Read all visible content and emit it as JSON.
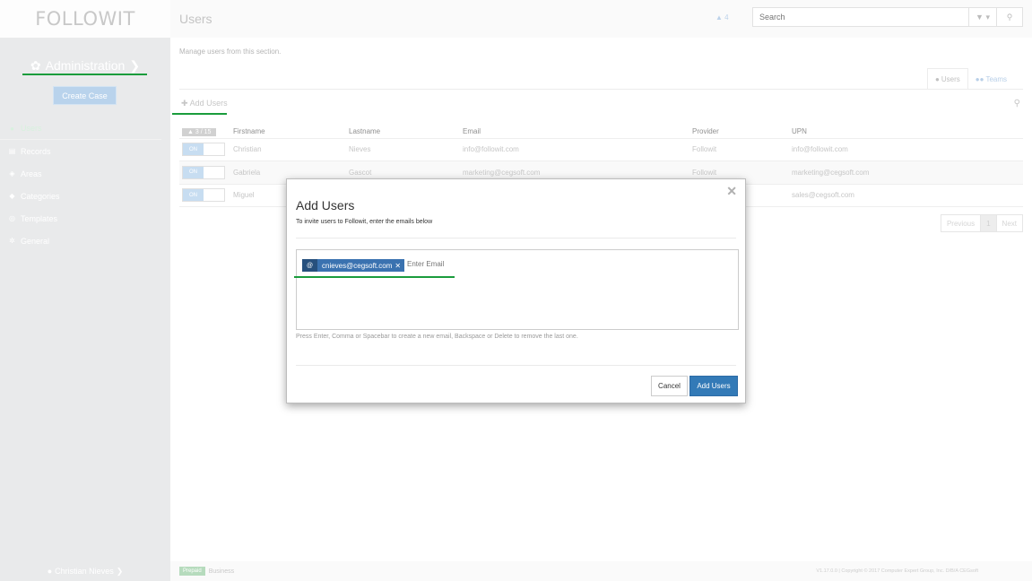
{
  "app": {
    "logo": "FOLLOWIT"
  },
  "sidebar": {
    "section_title": "Administration",
    "create_case": "Create Case",
    "items": [
      {
        "label": "Users",
        "icon": "user-icon"
      },
      {
        "label": "Records",
        "icon": "records-icon"
      },
      {
        "label": "Areas",
        "icon": "areas-icon"
      },
      {
        "label": "Categories",
        "icon": "tag-icon"
      },
      {
        "label": "Templates",
        "icon": "templates-icon"
      },
      {
        "label": "General",
        "icon": "gears-icon"
      }
    ],
    "user_name": "Christian Nieves"
  },
  "topbar": {
    "title": "Users",
    "notification_count": "4",
    "search_placeholder": "Search"
  },
  "main": {
    "subtitle": "Manage users from this section.",
    "tabs": [
      {
        "label": "Users"
      },
      {
        "label": "Teams"
      }
    ],
    "add_users_link": "Add Users",
    "table": {
      "count": "3 / 15",
      "headers": [
        "Firstname",
        "Lastname",
        "Email",
        "Provider",
        "UPN"
      ],
      "rows": [
        {
          "toggle": "ON",
          "firstname": "Christian",
          "lastname": "Nieves",
          "email": "info@followit.com",
          "provider": "Followit",
          "upn": "info@followit.com"
        },
        {
          "toggle": "ON",
          "firstname": "Gabriela",
          "lastname": "Gascot",
          "email": "marketing@cegsoft.com",
          "provider": "Followit",
          "upn": "marketing@cegsoft.com"
        },
        {
          "toggle": "ON",
          "firstname": "Miguel",
          "lastname": "",
          "email": "",
          "provider": "",
          "upn": "sales@cegsoft.com"
        }
      ]
    },
    "pager": {
      "previous": "Previous",
      "current": "1",
      "next": "Next"
    }
  },
  "footer": {
    "badge": "Prepaid",
    "plan": "Business",
    "copyright": "V1.17.0.0 | Copyright © 2017 Computer Expert Group, Inc. D/B/A CEGsoft"
  },
  "modal": {
    "title": "Add Users",
    "description": "To invite users to Followit, enter the emails below",
    "chip_email": "cnieves@cegsoft.com",
    "input_placeholder": "Enter Email",
    "help": "Press Enter, Comma or Spacebar to create a new email, Backspace or Delete to remove the last one.",
    "cancel": "Cancel",
    "submit": "Add Users"
  },
  "colors": {
    "accent_green": "#1a9c3c",
    "primary_blue": "#337ab7",
    "chip_blue": "#3a72b0"
  }
}
